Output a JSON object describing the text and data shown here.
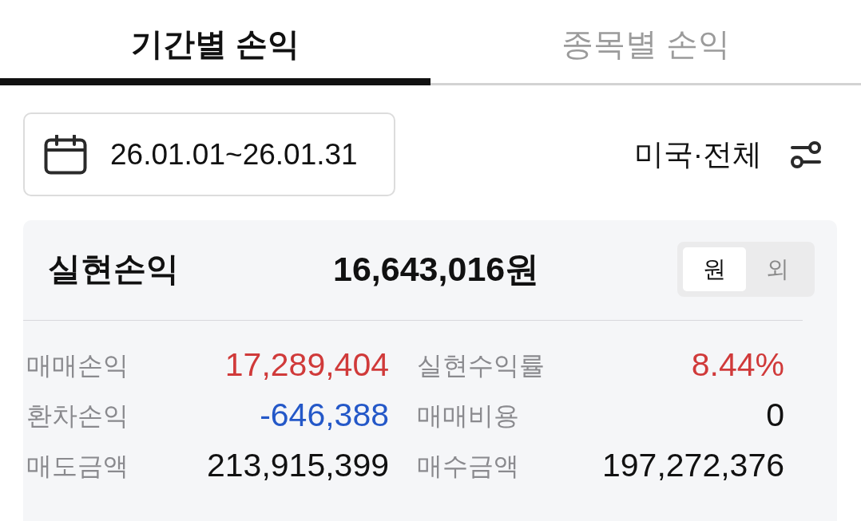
{
  "tabs": [
    {
      "label": "기간별 손익",
      "selected": true
    },
    {
      "label": "종목별 손익",
      "selected": false
    }
  ],
  "date_range": {
    "value": "26.01.01~26.01.31"
  },
  "filter": {
    "label": "미국·전체"
  },
  "summary": {
    "title": "실현손익",
    "total": "16,643,016원",
    "currency_toggle": [
      {
        "label": "원",
        "selected": true
      },
      {
        "label": "외",
        "selected": false
      }
    ],
    "metrics": [
      {
        "label": "매매손익",
        "value": "17,289,404",
        "color": "#d03a3a"
      },
      {
        "label": "실현수익률",
        "value": "8.44%",
        "color": "#d03a3a"
      },
      {
        "label": "환차손익",
        "value": "-646,388",
        "color": "#2458c8"
      },
      {
        "label": "매매비용",
        "value": "0",
        "color": "#111111"
      },
      {
        "label": "매도금액",
        "value": "213,915,399",
        "color": "#111111"
      },
      {
        "label": "매수금액",
        "value": "197,272,376",
        "color": "#111111"
      }
    ]
  }
}
